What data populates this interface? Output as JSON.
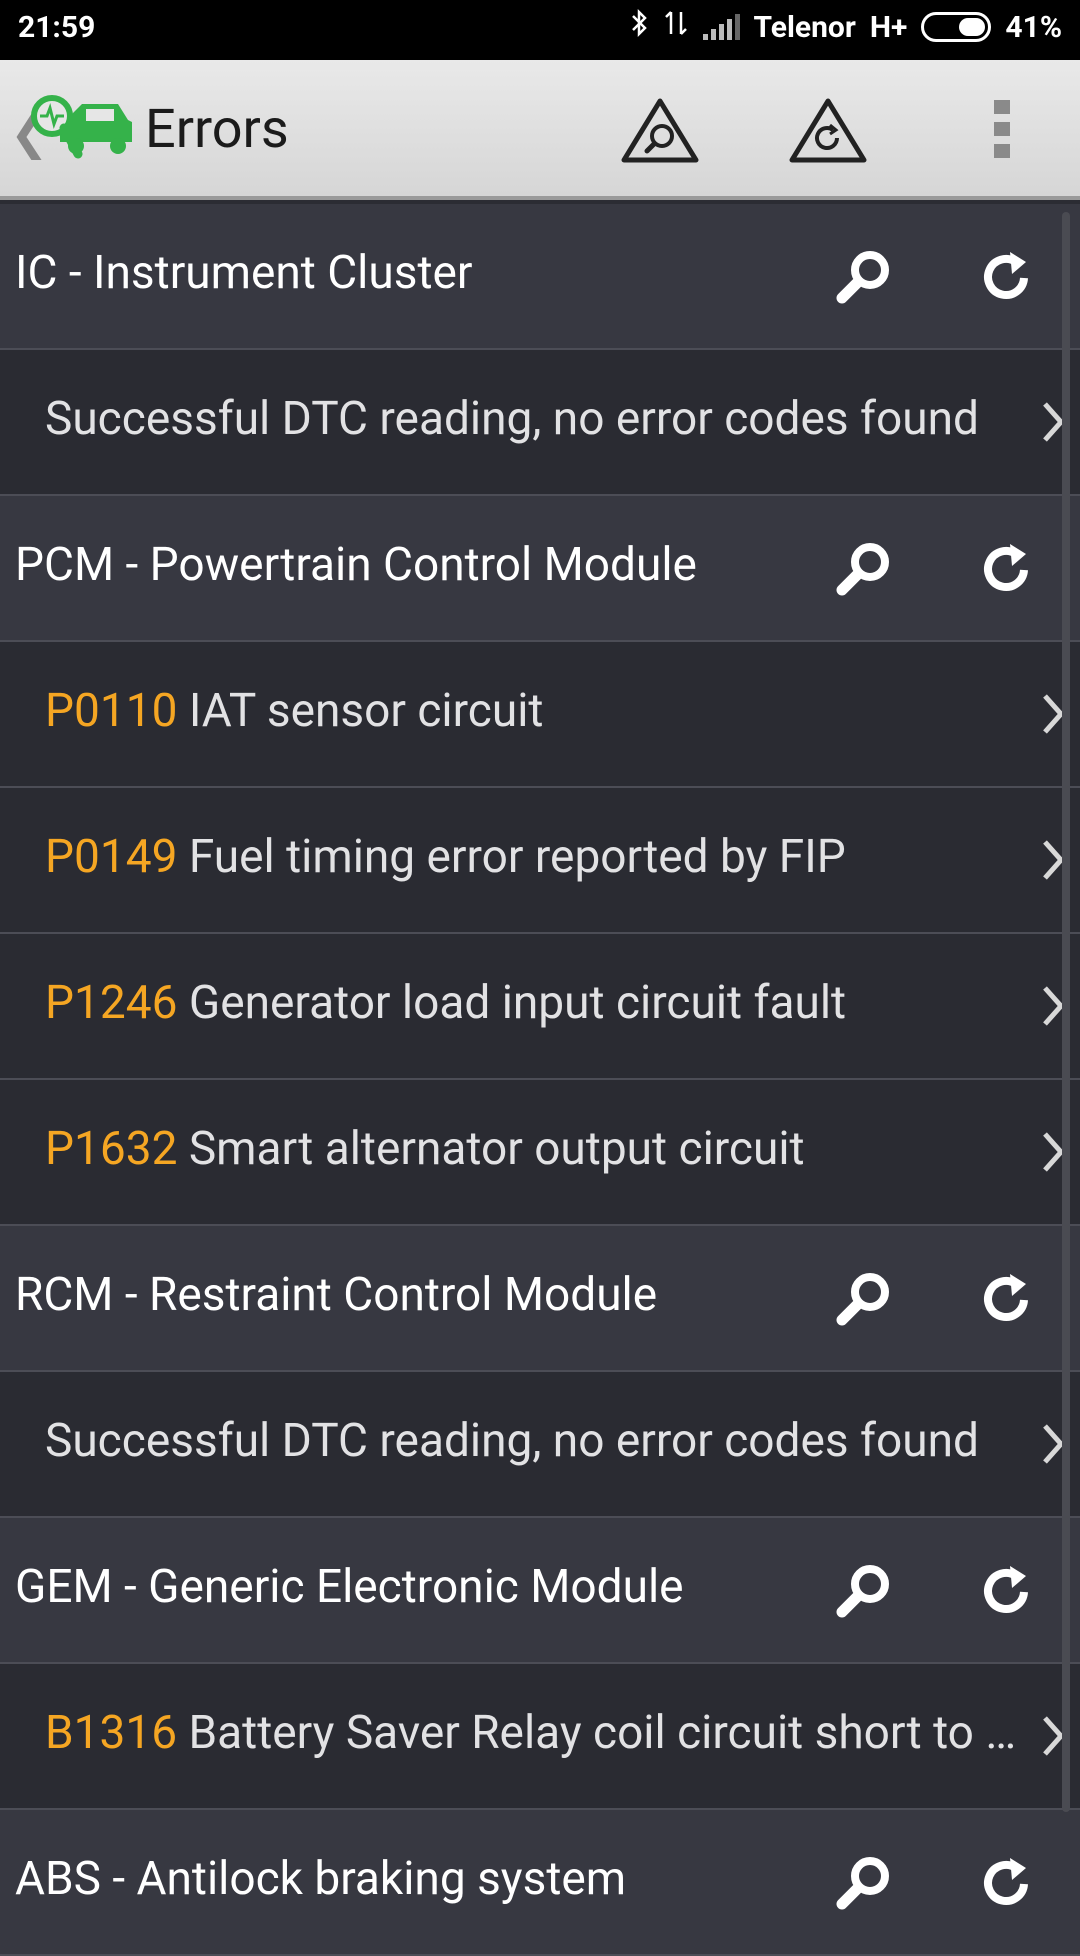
{
  "status_bar": {
    "time": "21:59",
    "carrier": "Telenor",
    "network": "H+",
    "battery": "41%",
    "battery_level": 0.41
  },
  "app_bar": {
    "title": "Errors",
    "icons": [
      "back-chevron-icon",
      "car-diagnostics-logo",
      "read-errors-icon",
      "refresh-errors-icon",
      "overflow-menu-icon"
    ]
  },
  "list": {
    "rows": [
      {
        "type": "module",
        "title": "IC - Instrument Cluster"
      },
      {
        "type": "dtc",
        "code": "",
        "text": "Successful DTC reading, no error codes found"
      },
      {
        "type": "module",
        "title": "PCM - Powertrain Control Module"
      },
      {
        "type": "dtc",
        "code": "P0110",
        "text": "IAT sensor circuit"
      },
      {
        "type": "dtc",
        "code": "P0149",
        "text": "Fuel timing error reported by FIP"
      },
      {
        "type": "dtc",
        "code": "P1246",
        "text": "Generator load input circuit fault"
      },
      {
        "type": "dtc",
        "code": "P1632",
        "text": "Smart alternator output circuit"
      },
      {
        "type": "module",
        "title": "RCM - Restraint Control Module"
      },
      {
        "type": "dtc",
        "code": "",
        "text": "Successful DTC reading, no error codes found"
      },
      {
        "type": "module",
        "title": "GEM - Generic Electronic Module"
      },
      {
        "type": "dtc",
        "code": "B1316",
        "text": "Battery Saver Relay coil circuit short to …"
      },
      {
        "type": "module",
        "title": "ABS - Antilock braking system"
      }
    ]
  },
  "colors": {
    "code_accent": "#f5a623",
    "module_row_bg": "#373841",
    "dtc_row_bg": "#2a2b32",
    "logo_green": "#35b24a"
  }
}
